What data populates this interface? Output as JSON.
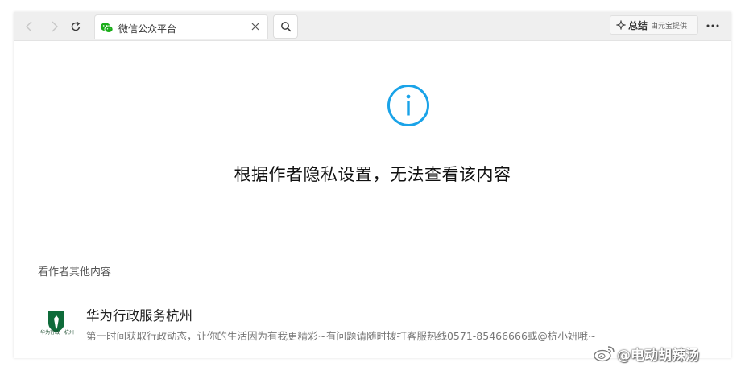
{
  "browser": {
    "tab_title": "微信公众平台",
    "summary_label": "总结",
    "summary_provider": "由元宝提供"
  },
  "content": {
    "privacy_message": "根据作者隐私设置，无法查看该内容",
    "section_title": "看作者其他内容"
  },
  "account": {
    "name": "华为行政服务杭州",
    "description": "第一时间获取行政动态，让你的生活因为有我更精彩~有问题请随时拨打客服热线0571-85466666或@杭小妍哦~",
    "logo_text": "华为行政 · 杭州",
    "logo_color": "#0e6b3a"
  },
  "watermark": {
    "text": "@电动胡辣汤"
  },
  "colors": {
    "info_icon": "#1aa3e8",
    "wechat_green": "#1aad19"
  }
}
